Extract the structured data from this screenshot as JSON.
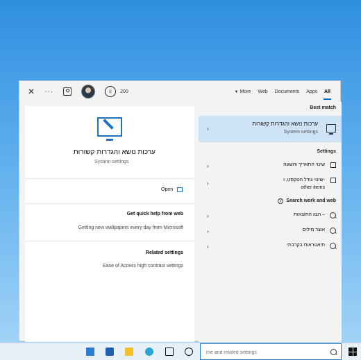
{
  "top_tabs": {
    "all": "All",
    "apps": "Apps",
    "documents": "Documents",
    "web": "Web",
    "more": "More"
  },
  "top_actions": {
    "rewards_points": "200"
  },
  "sections": {
    "best_match": "Best match",
    "settings": "Settings",
    "search_work_web": "Search work and web"
  },
  "best_match_item": {
    "title": "ערכות נושא והגדרות קשורות",
    "subtitle": "System settings"
  },
  "settings_items": [
    {
      "label": "שינוי התאריך והשעה"
    },
    {
      "label": "שינוי גודל הטקסט, ו-",
      "label2": "other items"
    }
  ],
  "web_items": [
    {
      "label": "הצג התוצאות –"
    },
    {
      "label": "אוצר מילים"
    },
    {
      "label": "תיאטראות בקרבתי"
    }
  ],
  "detail": {
    "title": "ערכות נושא והגדרות קשורות",
    "subtitle": "System settings",
    "open_label": "Open",
    "quick_help_heading": "Get quick help from web",
    "quick_help_item": "Getting new wallpapers every day from Microsoft",
    "related_heading": "Related settings",
    "related_item": "Ease of Access high contrast settings"
  },
  "taskbar": {
    "search_placeholder": "me and related settings"
  }
}
